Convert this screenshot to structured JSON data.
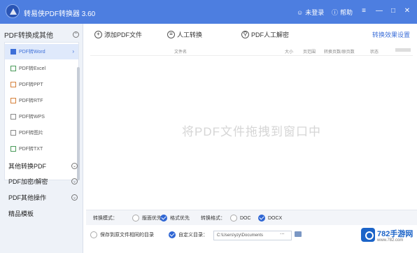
{
  "titlebar": {
    "app_title": "转易侠PDF转换器 3.60",
    "login": "未登录",
    "help": "帮助",
    "colors": {
      "bar": "#4d7ee0"
    }
  },
  "sidebar": {
    "header": "PDF转换成其他",
    "items": [
      {
        "label": "PDF转Word",
        "active": true
      },
      {
        "label": "PDF转Excel"
      },
      {
        "label": "PDF转PPT"
      },
      {
        "label": "PDF转RTF"
      },
      {
        "label": "PDF转WPS"
      },
      {
        "label": "PDF转图片"
      },
      {
        "label": "PDF转TXT"
      }
    ],
    "categories": [
      {
        "label": "其他转换PDF"
      },
      {
        "label": "PDF加密/解密"
      },
      {
        "label": "PDF其他操作"
      },
      {
        "label": "精品模板"
      }
    ]
  },
  "toolbar": {
    "add_file": "添加PDF文件",
    "manual": "人工转换",
    "pdf_decrypt": "PDF人工解密",
    "settings": "转换效果设置"
  },
  "table": {
    "columns": [
      "文件名",
      "大小",
      "页范围",
      "转换页数/原页数",
      "状态"
    ]
  },
  "drop_hint": "将PDF文件拖拽到窗口中",
  "options": {
    "mode_label": "转换模式：",
    "mode_layout": "版面优先",
    "mode_format": "格式优先",
    "format_label": "转换格式：",
    "fmt_doc": "DOC",
    "fmt_docx": "DOCX"
  },
  "output": {
    "same_dir": "保存到原文件相同的目录",
    "custom_dir": "自定义目录：",
    "path": "C:\\Users\\yzy\\Documents",
    "browse": "..."
  },
  "watermark": {
    "title": "782手游网",
    "url": "www.782.com"
  }
}
